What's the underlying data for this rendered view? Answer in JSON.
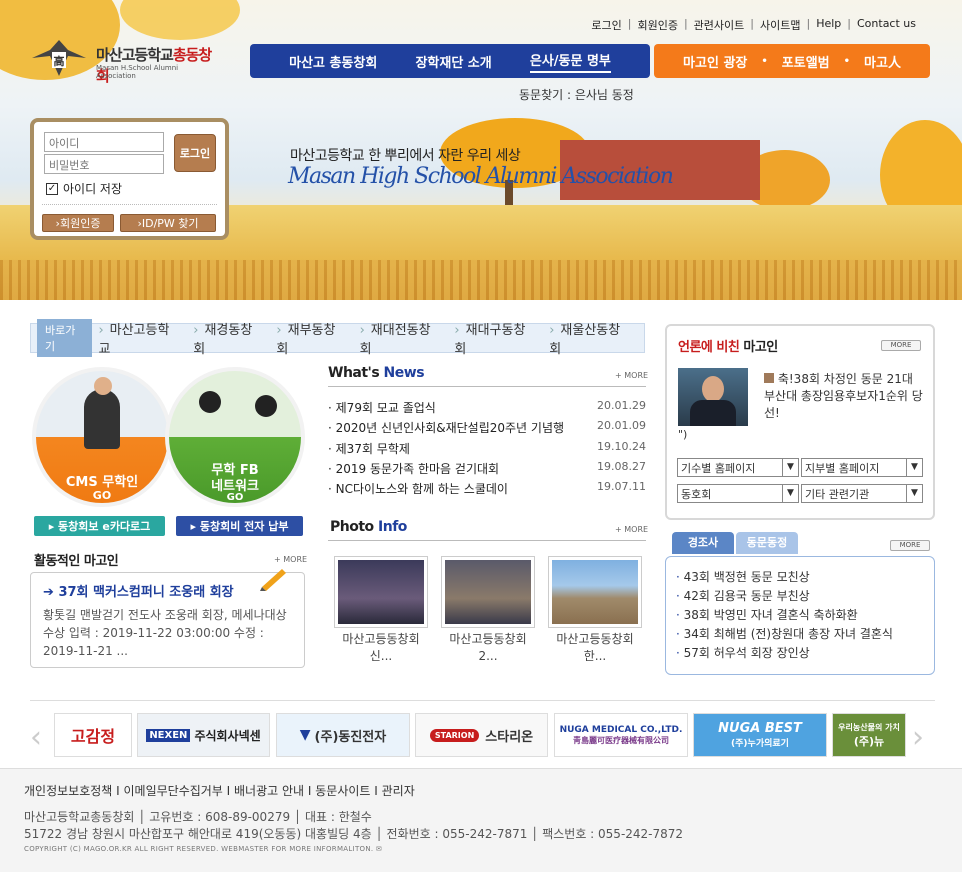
{
  "site": {
    "logo_title_a": "마산고등학교",
    "logo_title_b": "총동창회",
    "logo_subtitle": "Masan H.School Alumni Association"
  },
  "topnav": [
    "로그인",
    "회원인증",
    "관련사이트",
    "사이트맵",
    "Help",
    "Contact us"
  ],
  "mainnav": [
    "마산고 총동창회",
    "장학재단 소개",
    "은사/동문 명부"
  ],
  "subnav": [
    "마고인 광장",
    "포토앨범",
    "마고人"
  ],
  "search_line": "동문찾기 : 은사님 동정",
  "slogan": "마산고등학교 한 뿌리에서 자란 우리 세상",
  "slogan_en": "Masan High School Alumni Association",
  "login": {
    "id_placeholder": "아이디",
    "pw_placeholder": "비밀번호",
    "login_button": "로그인",
    "save_id": "아이디 저장",
    "member_auth": "회원인증",
    "find_idpw": "ID/PW 찾기"
  },
  "quick": {
    "label": "바로가기",
    "items": [
      "마산고등학교",
      "재경동창회",
      "재부동창회",
      "재대전동창회",
      "재대구동창회",
      "재울산동창회"
    ]
  },
  "circles": {
    "cms_line1": "CMS 무학인",
    "cms_line2": "GO",
    "fb_line1": "무학 FB",
    "fb_line2": "네트워크",
    "fb_line3": "GO"
  },
  "promo_buttons": [
    "동창회보 e카다로그",
    "동창회비 전자 납부"
  ],
  "whats_news": {
    "title_a": "What's",
    "title_b": "News",
    "more": "+ MORE",
    "items": [
      {
        "title": "제79회 모교 졸업식",
        "date": "20.01.29"
      },
      {
        "title": "2020년 신년인사회&재단설립20주년 기념행",
        "date": "20.01.09"
      },
      {
        "title": "제37회 무학제",
        "date": "19.10.24"
      },
      {
        "title": "2019 동문가족 한마음 걷기대회",
        "date": "19.08.27"
      },
      {
        "title": "NC다이노스와 함께 하는 스쿨데이",
        "date": "19.07.11"
      }
    ]
  },
  "photo_info": {
    "title_a": "Photo",
    "title_b": "Info",
    "more": "+ MORE",
    "items": [
      {
        "line1": "마산고등동창회",
        "line2": "신..."
      },
      {
        "line1": "마산고등동창회",
        "line2": "2..."
      },
      {
        "line1": "마산고등동창회",
        "line2": "한..."
      }
    ]
  },
  "active": {
    "title": "활동적인 마고인",
    "more": "+ MORE",
    "headline": "37회 맥커스컴퍼니 조웅래 회장",
    "body": "황톳길 맨발걷기 전도사 조웅래 회장, 메세나대상 수상 입력 : 2019-11-22 03:00:00 수정 : 2019-11-21 ..."
  },
  "press": {
    "title_a": "언론에 비친",
    "title_b": "마고인",
    "more": "MORE",
    "text": "축!38회 차정인 동문 21대 부산대 총장임용후보자1순위 당선!",
    "text2": "\")"
  },
  "selects": [
    "기수별 홈페이지",
    "지부별 홈페이지",
    "동호회",
    "기타 관련기관"
  ],
  "events": {
    "tab_active": "경조사",
    "tab_other": "동문동정",
    "more": "MORE",
    "items": [
      "43회 백정현 동문 모친상",
      "42회 김용국 동문 부친상",
      "38회 박영민 자녀 결혼식 축하화환",
      "34회 최해범 (전)창원대 총장 자녀 결혼식",
      "57회 허우석 회장 장인상"
    ]
  },
  "banners": [
    "고감정",
    "주식회사넥센",
    "(주)동진전자",
    "스타리온",
    "NUGA MEDICAL CO.,LTD.",
    "NUGA BEST",
    "(주)뉴"
  ],
  "banner_sub": {
    "nuga_medical": "靑島麗可医疗器械有限公司",
    "nuga_best": "(주)누가의료기",
    "ngf_top": "우리농산물의 가치"
  },
  "footer": {
    "links": "개인정보보호정책 I 이메일무단수집거부 I 배너광고 안내 I 동문사이트 I 관리자",
    "line1": "마산고등학교총동창회 │ 고유번호 : 608-89-00279 │ 대표 : 한철수",
    "line2": "51722 경남 창원시 마산합포구 해안대로 419(오동동) 대홍빌딩 4층 │ 전화번호 : 055-242-7871 │ 팩스번호 : 055-242-7872",
    "copyright": "COPYRIGHT (C) MAGO.OR.KR ALL RIGHT RESERVED. WEBMASTER FOR MORE INFORMALITON."
  },
  "colors": {
    "navy": "#1f3f9c",
    "orange": "#f47a1a",
    "brown": "#b57d4f",
    "teal": "#2aa7a0"
  }
}
